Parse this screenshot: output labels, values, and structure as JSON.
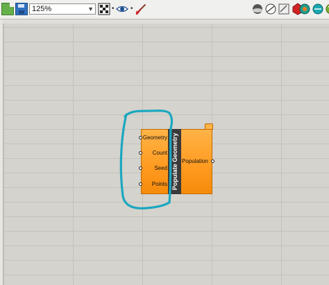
{
  "toolbar": {
    "zoom": {
      "value": "125%"
    },
    "icons": [
      "new-document-icon",
      "save-icon",
      "zoom-extents-icon",
      "preview-icon",
      "display-colours-icon",
      "shaded-preview-icon",
      "wireframe-preview-icon",
      "custom-preview-icon",
      "bake-icon",
      "selected-only-icon",
      "render-icon"
    ]
  },
  "component": {
    "name": "Populate Geometry",
    "inputs": [
      "Geometry",
      "Count",
      "Seed",
      "Points"
    ],
    "output": "Population"
  },
  "colors": {
    "component_fill": "#ff9a1f",
    "annotation_stroke": "#1ba7c0",
    "canvas": "#d4d3cd"
  }
}
